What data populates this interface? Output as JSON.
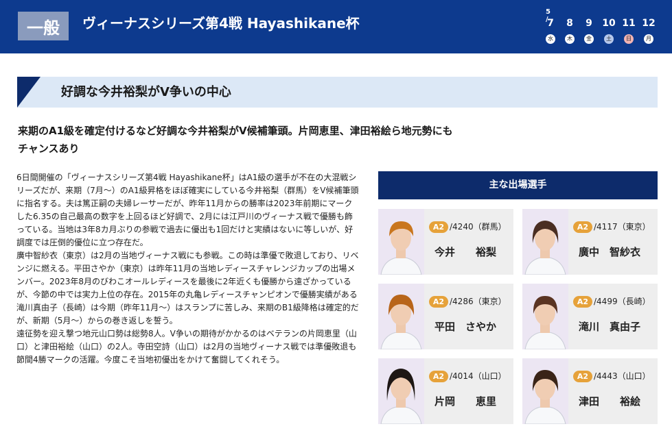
{
  "header": {
    "grade": "一般",
    "title": "ヴィーナスシリーズ第4戦 Hayashikane杯",
    "month": "5 /",
    "days": [
      {
        "num": "7",
        "dow": "水"
      },
      {
        "num": "8",
        "dow": "木"
      },
      {
        "num": "9",
        "dow": "金"
      },
      {
        "num": "10",
        "dow": "土"
      },
      {
        "num": "11",
        "dow": "日"
      },
      {
        "num": "12",
        "dow": "月"
      }
    ]
  },
  "section": {
    "heading": "好調な今井裕梨がV争いの中心"
  },
  "lead": {
    "line1": "来期のA1級を確定付けるなど好調な今井裕梨がV候補筆頭。片岡恵里、津田裕絵ら地元勢にも",
    "line2": "チャンスあり"
  },
  "article": {
    "paragraphs": [
      "6日間開催の「ヴィーナスシリーズ第4戦 Hayashikane杯」はA1級の選手が不在の大混戦シリーズだが、来期（7月～）のA1級昇格をほぼ確実にしている今井裕梨（群馬）をV候補筆頭に指名する。夫は篤正嗣の夫婦レーサーだが、昨年11月からの勝率は2023年前期にマークした6.35の自己最高の数字を上回るほど好調で、2月には江戸川のヴィーナス戦で優勝も飾っている。当地は3年8カ月ぶりの参戦で過去に優出も1回だけと実績はないに等しいが、好調度では圧倒的優位に立つ存在だ。",
      "廣中智紗衣（東京）は2月の当地ヴィーナス戦にも参戦。この時は準優で敗退しており、リベンジに燃える。平田さやか（東京）は昨年11月の当地レディースチャレンジカップの出場メンバー。2023年8月のびわこオールレディースを最後に2年近くも優勝から遠ざかっているが、今節の中では実力上位の存在。2015年の丸亀レディースチャンピオンで優勝実績がある滝川真由子（長崎）は今期（昨年11月～）はスランプに苦しみ、来期のB1級降格は確定的だが、新期（5月～）からの巻き返しを誓う。",
      "遠征勢を迎え撃つ地元山口勢は総勢8人。V争いの期待がかかるのはベテランの片岡恵里（山口）と津田裕絵（山口）の2人。寺田空詩（山口）は2月の当地ヴィーナス戦では準優敗退も節間4勝マークの活躍。今度こそ当地初優出をかけて奮闘してくれそう。"
    ]
  },
  "racers_panel": {
    "title": "主な出場選手",
    "racers": [
      {
        "grade": "A2",
        "reg": "/4240（群馬）",
        "name": "今井　　裕梨"
      },
      {
        "grade": "A2",
        "reg": "/4117（東京）",
        "name": "廣中　智紗衣"
      },
      {
        "grade": "A2",
        "reg": "/4286（東京）",
        "name": "平田　さやか"
      },
      {
        "grade": "A2",
        "reg": "/4499（長崎）",
        "name": "滝川　真由子"
      },
      {
        "grade": "A2",
        "reg": "/4014（山口）",
        "name": "片岡　　恵里"
      },
      {
        "grade": "A2",
        "reg": "/4443（山口）",
        "name": "津田　　裕絵"
      }
    ]
  },
  "colors": {
    "header_bg": "#0d3a8e",
    "panel_title_bg": "#0d2b6b",
    "section_bg": "#dce8f6",
    "badge": "#e6a23a"
  }
}
